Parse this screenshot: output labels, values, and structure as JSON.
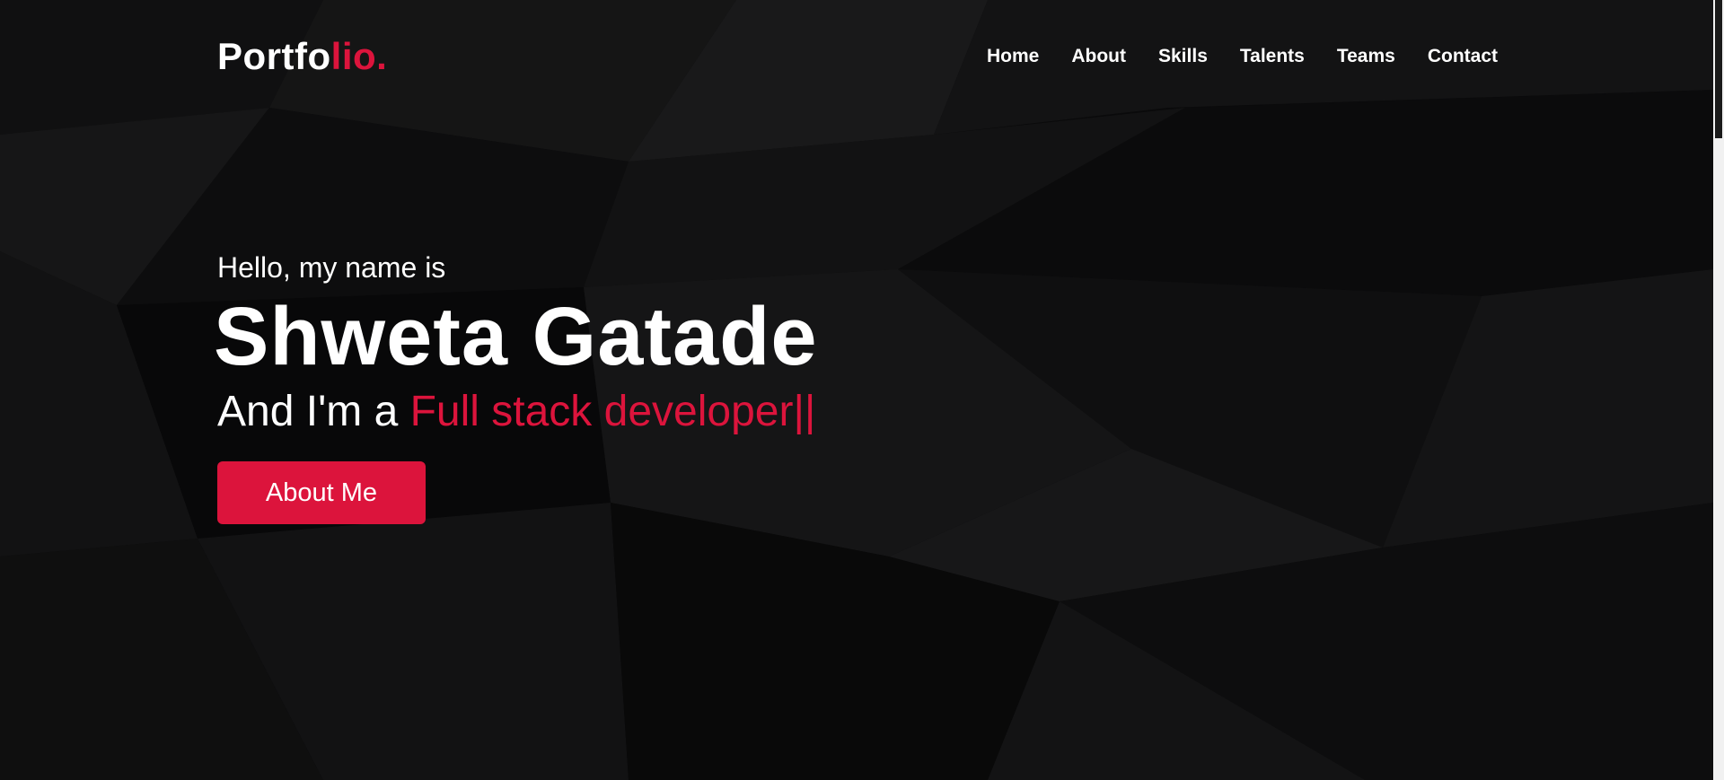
{
  "navbar": {
    "brand_main": "Portfo",
    "brand_accent": "lio.",
    "items": [
      {
        "label": "Home"
      },
      {
        "label": "About"
      },
      {
        "label": "Skills"
      },
      {
        "label": "Talents"
      },
      {
        "label": "Teams"
      },
      {
        "label": "Contact"
      }
    ]
  },
  "hero": {
    "greeting": "Hello, my name is",
    "name": "Shweta Gatade",
    "role_prefix": "And I'm a ",
    "role": "Full stack developer||",
    "cta_label": "About Me"
  },
  "colors": {
    "accent": "#dc143c",
    "background": "#0e0e0f",
    "text": "#ffffff"
  }
}
